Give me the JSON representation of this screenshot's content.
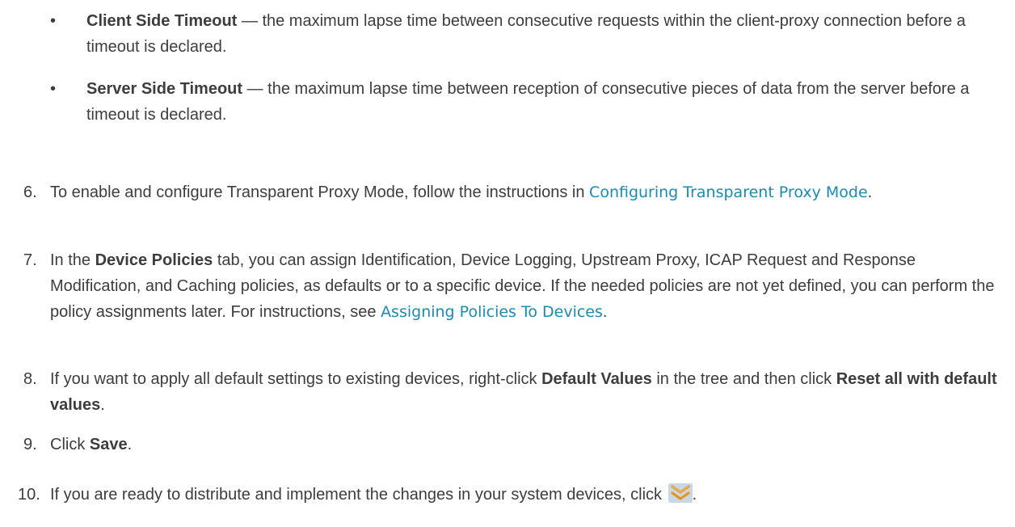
{
  "bullets": [
    {
      "term": "Client Side Timeout",
      "text": " — the maximum lapse time between consecutive requests within the client-proxy connection before a timeout is declared."
    },
    {
      "term": "Server Side Timeout",
      "text": " — the maximum lapse time between reception of consecutive pieces of data from the server before a timeout is declared."
    }
  ],
  "steps": {
    "s6": {
      "num": "6.",
      "text_before": "To enable and configure Transparent Proxy Mode, follow the instructions in ",
      "link": "Configuring Transparent Proxy Mode",
      "text_after": "."
    },
    "s7": {
      "num": "7.",
      "text1": "In the ",
      "bold1": "Device Policies",
      "text2": " tab, you can assign Identification, Device Logging, Upstream Proxy, ICAP Request and Response Modification, and Caching policies, as defaults or to a specific device. If the needed policies are not yet defined, you can perform the policy assignments later. For instructions, see ",
      "link": "Assigning Policies To Devices",
      "text3": "."
    },
    "s8": {
      "num": "8.",
      "text1": "If you want to apply all default settings to existing devices, right-click ",
      "bold1": "Default Values",
      "text2": " in the tree and then click ",
      "bold2": "Reset all with default values",
      "text3": "."
    },
    "s9": {
      "num": "9.",
      "text1": "Click ",
      "bold1": "Save",
      "text2": "."
    },
    "s10": {
      "num": "10.",
      "text1": "If you are ready to distribute and implement the changes in your system devices, click ",
      "text2": ".",
      "icon": "distribute-icon"
    }
  },
  "bullet_glyph": "•",
  "colors": {
    "text": "#3d3d3d",
    "link": "#1a8bb5",
    "icon_bg": "#c8d8e4",
    "icon_fg": "#e8941c"
  }
}
